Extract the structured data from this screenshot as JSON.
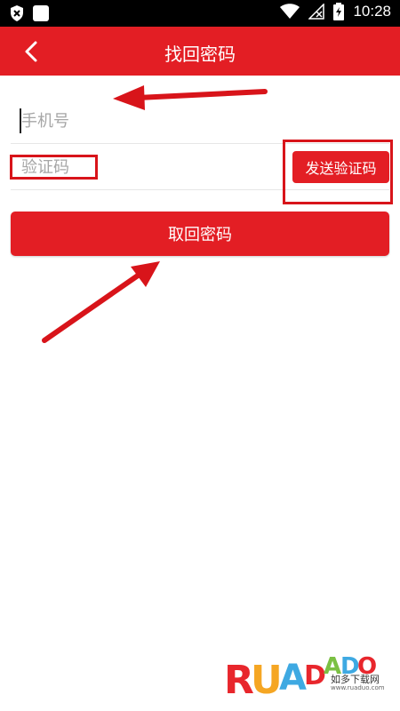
{
  "status_bar": {
    "time": "10:28",
    "icons": [
      "shield-notification-icon",
      "square-notification-icon",
      "wifi-icon",
      "no-signal-icon",
      "battery-charging-icon"
    ]
  },
  "header": {
    "title": "找回密码",
    "back_icon": "chevron-left-icon"
  },
  "form": {
    "phone_placeholder": "手机号",
    "code_placeholder": "验证码",
    "send_code_label": "发送验证码",
    "submit_label": "取回密码"
  },
  "colors": {
    "brand_red": "#e31e24",
    "annotation_red": "#d8141a",
    "placeholder": "#a6a6a6"
  },
  "watermark": {
    "logo_text": "RUAODADUO",
    "subtitle": "如多下载网",
    "url": "www.ruaduo.com"
  }
}
